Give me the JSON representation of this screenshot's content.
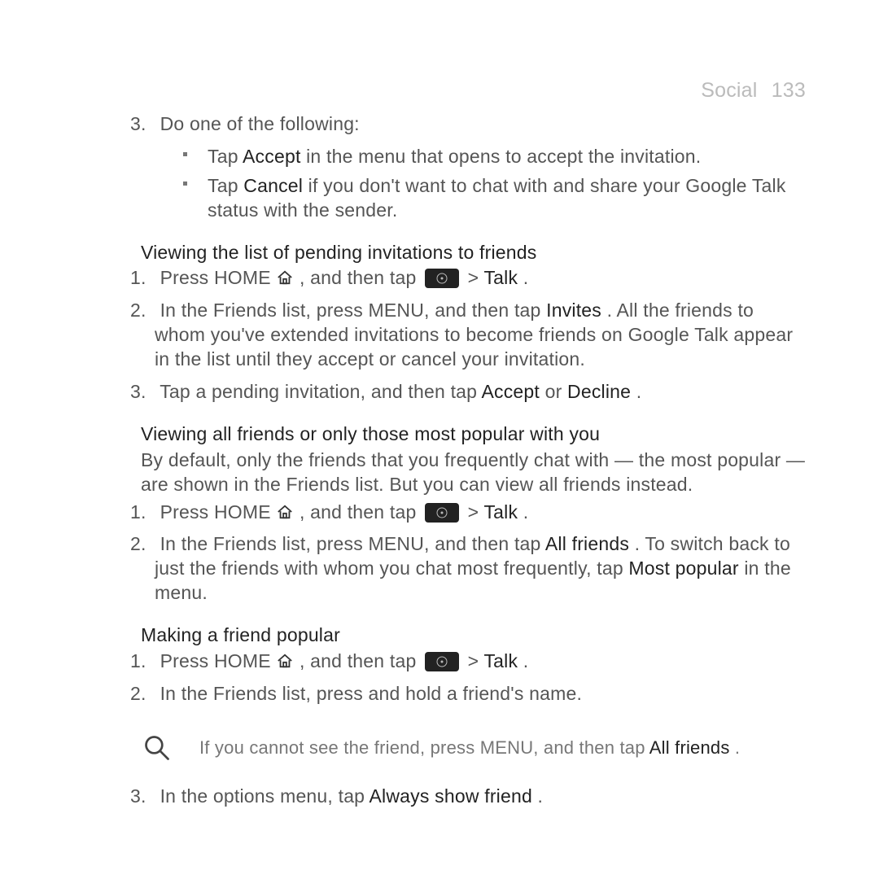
{
  "header": {
    "section": "Social",
    "pagenum": "133"
  },
  "top_step": {
    "num": "3.",
    "text": "Do one of the following:",
    "bullets": [
      {
        "pre": "Tap ",
        "bold": "Accept",
        "post": "  in the menu that opens to accept the invitation."
      },
      {
        "pre": "Tap ",
        "bold": "Cancel",
        "post": " if you don't want to chat with and share your Google Talk status with the sender."
      }
    ]
  },
  "sec1": {
    "title": "Viewing the list of pending invitations to friends",
    "steps": [
      {
        "num": "1.",
        "a": "Press HOME ",
        "b": ", and then tap ",
        "c": " > ",
        "d": "Talk",
        "e": " ."
      },
      {
        "num": "2.",
        "a": "In the Friends list, press MENU, and then tap ",
        "bold": "Invites",
        "b": " . All the friends to whom you've extended invitations to become friends on Google Talk appear in the list until they accept or cancel your invitation."
      },
      {
        "num": "3.",
        "a": "Tap a pending invitation, and then tap ",
        "bold1": "Accept",
        "b": "  or ",
        "bold2": "Decline",
        "c": " ."
      }
    ]
  },
  "sec2": {
    "title": "Viewing all friends or only those most popular with you",
    "intro": "By default, only the friends that you frequently chat with — the most popular — are shown in the Friends list. But you can view all friends instead.",
    "steps": [
      {
        "num": "1.",
        "a": "Press HOME ",
        "b": ", and then tap ",
        "c": " > ",
        "d": "Talk",
        "e": " ."
      },
      {
        "num": "2.",
        "a": "In the Friends list, press MENU, and then tap ",
        "bold1": "All friends",
        "b": "  . To switch back to just the friends with whom you chat most frequently, tap ",
        "bold2": "Most popular",
        "c": "   in the menu."
      }
    ]
  },
  "sec3": {
    "title": "Making a friend popular",
    "steps": [
      {
        "num": "1.",
        "a": "Press HOME ",
        "b": ", and then tap ",
        "c": " > ",
        "d": "Talk",
        "e": " ."
      },
      {
        "num": "2.",
        "text": "In the Friends list, press and hold a friend's name."
      }
    ],
    "note": {
      "a": "If you cannot see the friend, press MENU, and then tap ",
      "bold": "All friends",
      "b": "  ."
    },
    "step3": {
      "num": "3.",
      "a": "In the options menu, tap ",
      "bold": "Always show friend",
      "b": "   ."
    }
  }
}
